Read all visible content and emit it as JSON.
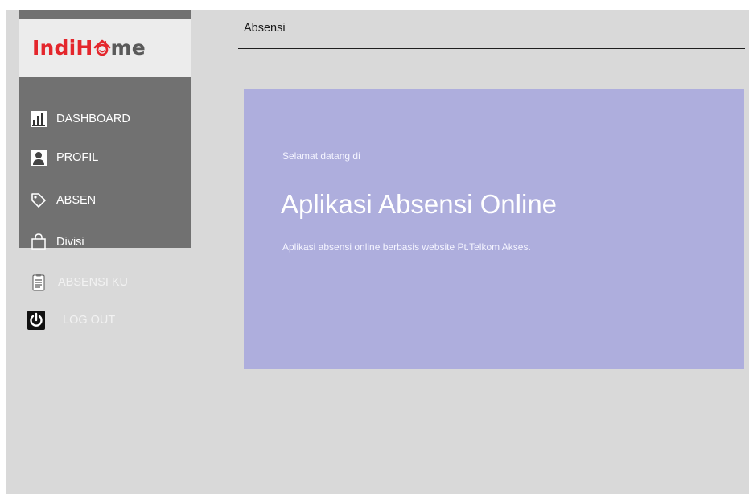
{
  "brand": {
    "logo_text_part1": "Indi",
    "logo_text_part2": "H",
    "logo_text_part3": "me",
    "primary_color": "#e4262c",
    "secondary_color": "#5a5a5a"
  },
  "sidebar": {
    "background": "#717171",
    "items": [
      {
        "label": "DASHBOARD",
        "icon": "bar-chart-icon"
      },
      {
        "label": "PROFIL",
        "icon": "user-icon"
      },
      {
        "label": "ABSEN",
        "icon": "tag-icon"
      },
      {
        "label": "Divisi",
        "icon": "shopping-bag-icon"
      },
      {
        "label": "ABSENSI KU",
        "icon": "clipboard-icon"
      },
      {
        "label": "LOG OUT",
        "icon": "power-icon"
      }
    ]
  },
  "header": {
    "title": "Absensi"
  },
  "hero": {
    "background": "#aeaedd",
    "greeting": "Selamat datang di",
    "title": "Aplikasi Absensi Online",
    "subtitle": "Aplikasi absensi online berbasis website Pt.Telkom Akses."
  }
}
